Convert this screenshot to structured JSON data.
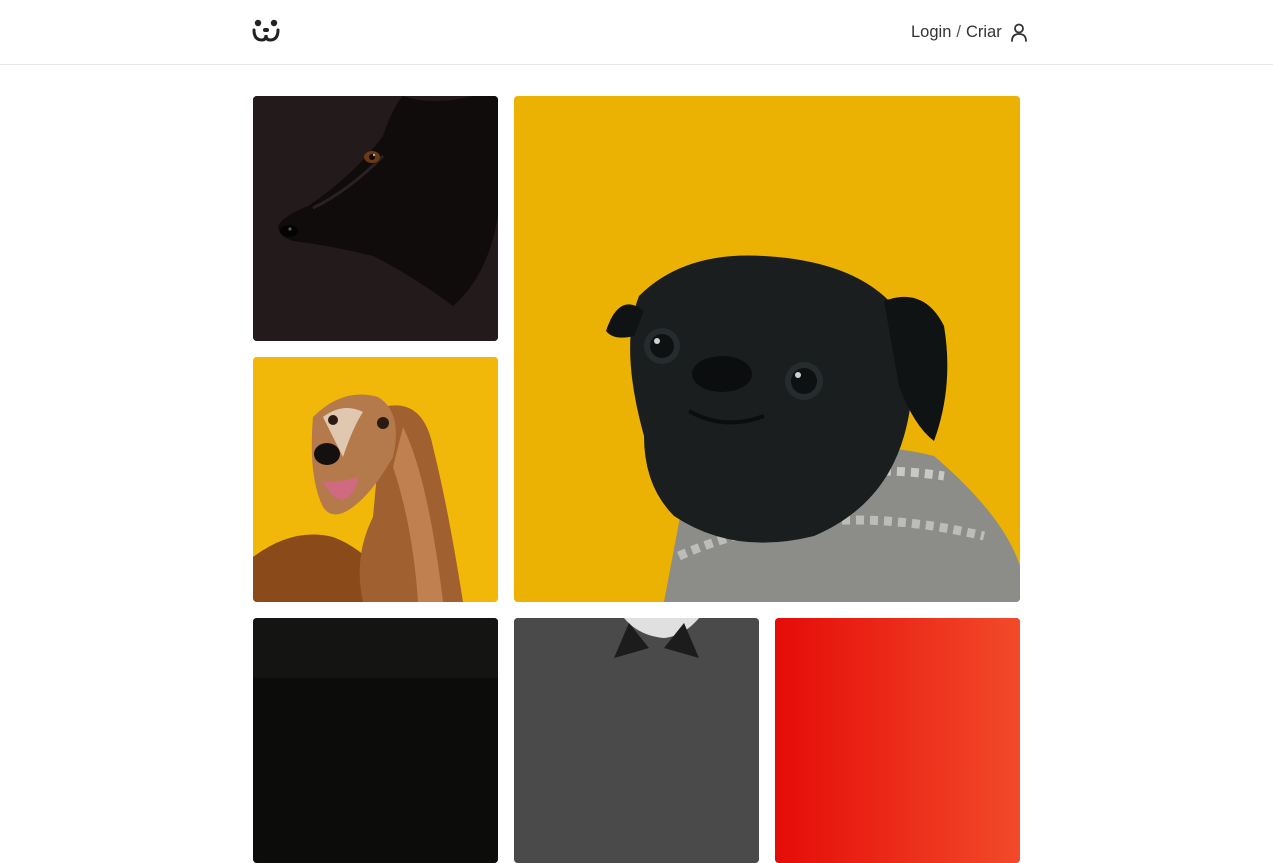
{
  "header": {
    "logo_icon": "dog-face-logo-icon",
    "login_label": "Login",
    "separator": "/",
    "create_label": "Criar",
    "user_icon": "user-icon"
  },
  "feed": {
    "photos": [
      {
        "subject": "black-dog",
        "background": "#231b1b"
      },
      {
        "subject": "pug-in-sweater",
        "background": "#ebb203"
      },
      {
        "subject": "afghan-hound",
        "background": "#f1b80a"
      },
      {
        "subject": "dark-photo",
        "background": "#0c0c0a"
      },
      {
        "subject": "dog-ears-photo",
        "background": "#4a4a4a"
      },
      {
        "subject": "red-photo",
        "background": "#e8140e"
      }
    ]
  }
}
